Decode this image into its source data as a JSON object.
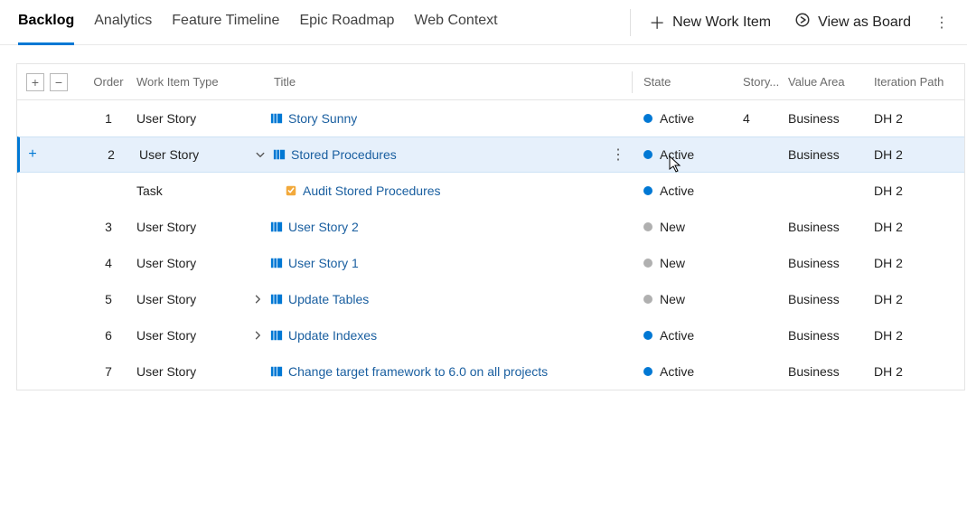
{
  "tabs": [
    {
      "label": "Backlog",
      "active": true
    },
    {
      "label": "Analytics",
      "active": false
    },
    {
      "label": "Feature Timeline",
      "active": false
    },
    {
      "label": "Epic Roadmap",
      "active": false
    },
    {
      "label": "Web Context",
      "active": false
    }
  ],
  "actions": {
    "new_work_item": "New Work Item",
    "view_as_board": "View as Board"
  },
  "columns": {
    "order": "Order",
    "type": "Work Item Type",
    "title": "Title",
    "state": "State",
    "story": "Story...",
    "value_area": "Value Area",
    "iteration": "Iteration Path"
  },
  "rows": [
    {
      "order": "1",
      "type": "User Story",
      "kind": "userstory",
      "title": "Story Sunny",
      "state": "Active",
      "state_kind": "active",
      "story_points": "4",
      "value_area": "Business",
      "iteration": "DH 2",
      "chev": "",
      "selected": false,
      "indent": 0
    },
    {
      "order": "2",
      "type": "User Story",
      "kind": "userstory",
      "title": "Stored Procedures",
      "state": "Active",
      "state_kind": "active",
      "story_points": "",
      "value_area": "Business",
      "iteration": "DH 2",
      "chev": "down",
      "selected": true,
      "indent": 0
    },
    {
      "order": "",
      "type": "Task",
      "kind": "task",
      "title": "Audit Stored Procedures",
      "state": "Active",
      "state_kind": "active",
      "story_points": "",
      "value_area": "",
      "iteration": "DH 2",
      "chev": "",
      "selected": false,
      "indent": 1
    },
    {
      "order": "3",
      "type": "User Story",
      "kind": "userstory",
      "title": "User Story 2",
      "state": "New",
      "state_kind": "new",
      "story_points": "",
      "value_area": "Business",
      "iteration": "DH 2",
      "chev": "",
      "selected": false,
      "indent": 0
    },
    {
      "order": "4",
      "type": "User Story",
      "kind": "userstory",
      "title": "User Story 1",
      "state": "New",
      "state_kind": "new",
      "story_points": "",
      "value_area": "Business",
      "iteration": "DH 2",
      "chev": "",
      "selected": false,
      "indent": 0
    },
    {
      "order": "5",
      "type": "User Story",
      "kind": "userstory",
      "title": "Update Tables",
      "state": "New",
      "state_kind": "new",
      "story_points": "",
      "value_area": "Business",
      "iteration": "DH 2",
      "chev": "right",
      "selected": false,
      "indent": 0
    },
    {
      "order": "6",
      "type": "User Story",
      "kind": "userstory",
      "title": "Update Indexes",
      "state": "Active",
      "state_kind": "active",
      "story_points": "",
      "value_area": "Business",
      "iteration": "DH 2",
      "chev": "right",
      "selected": false,
      "indent": 0
    },
    {
      "order": "7",
      "type": "User Story",
      "kind": "userstory",
      "title": "Change target framework to 6.0 on all projects",
      "state": "Active",
      "state_kind": "active",
      "story_points": "",
      "value_area": "Business",
      "iteration": "DH 2",
      "chev": "",
      "selected": false,
      "indent": 0
    }
  ]
}
